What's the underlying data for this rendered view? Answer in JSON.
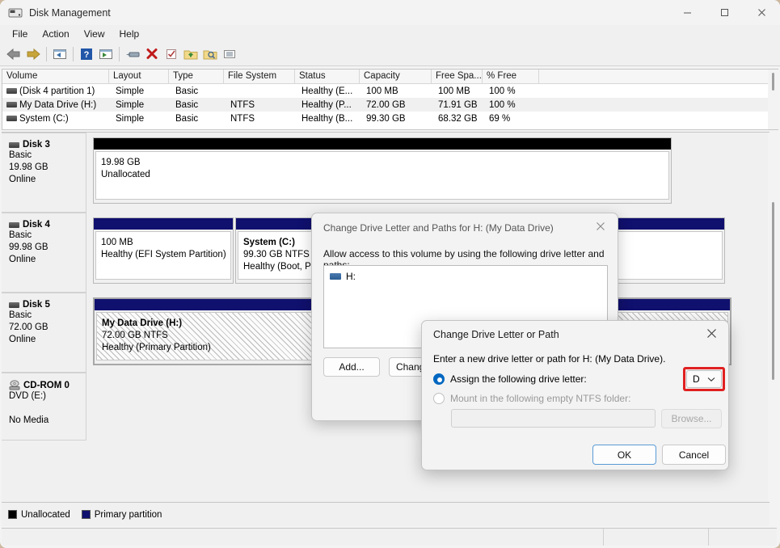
{
  "window": {
    "title": "Disk Management",
    "icon": "disk-management-icon",
    "minimize": "—",
    "maximize": "☐",
    "close": "✕"
  },
  "menu": {
    "items": [
      "File",
      "Action",
      "View",
      "Help"
    ]
  },
  "toolbar": {
    "icons": [
      "back-arrow-icon",
      "forward-arrow-icon",
      "sep",
      "up-one-level-icon",
      "sep",
      "help-icon",
      "show-hide-console-tree-icon",
      "sep",
      "properties-icon",
      "delete-icon",
      "check-icon",
      "export-list-icon",
      "find-icon",
      "view-list-icon"
    ]
  },
  "volume_list": {
    "columns": [
      "Volume",
      "Layout",
      "Type",
      "File System",
      "Status",
      "Capacity",
      "Free Spa...",
      "% Free"
    ],
    "rows": [
      {
        "volume": "(Disk 4 partition 1)",
        "layout": "Simple",
        "type": "Basic",
        "file_system": "",
        "status": "Healthy (E...",
        "capacity": "100 MB",
        "free_space": "100 MB",
        "percent_free": "100 %",
        "selected": false
      },
      {
        "volume": "My Data Drive (H:)",
        "layout": "Simple",
        "type": "Basic",
        "file_system": "NTFS",
        "status": "Healthy (P...",
        "capacity": "72.00 GB",
        "free_space": "71.91 GB",
        "percent_free": "100 %",
        "selected": true
      },
      {
        "volume": "System (C:)",
        "layout": "Simple",
        "type": "Basic",
        "file_system": "NTFS",
        "status": "Healthy (B...",
        "capacity": "99.30 GB",
        "free_space": "68.32 GB",
        "percent_free": "69 %",
        "selected": false
      }
    ]
  },
  "disk_map": {
    "disks": [
      {
        "name": "Disk 3",
        "type": "Basic",
        "size": "19.98 GB",
        "state": "Online",
        "partitions": [
          {
            "title": "",
            "line1": "19.98 GB",
            "line2": "Unallocated",
            "cap": "black",
            "selected": false
          }
        ]
      },
      {
        "name": "Disk 4",
        "type": "Basic",
        "size": "99.98 GB",
        "state": "Online",
        "partitions": [
          {
            "title": "",
            "line1": "100 MB",
            "line2": "Healthy (EFI System Partition)",
            "cap": "blue",
            "selected": false
          },
          {
            "title": "System  (C:)",
            "line1": "99.30 GB NTFS",
            "line2": "Healthy (Boot, Pag",
            "cap": "blue",
            "selected": false
          },
          {
            "title": "",
            "line1": "",
            "line2": "",
            "cap": "blue",
            "selected": false
          }
        ]
      },
      {
        "name": "Disk 5",
        "type": "Basic",
        "size": "72.00 GB",
        "state": "Online",
        "partitions": [
          {
            "title": "My Data Drive  (H:)",
            "line1": "72.00 GB NTFS",
            "line2": "Healthy (Primary Partition)",
            "cap": "blue",
            "selected": true
          }
        ]
      },
      {
        "name": "CD-ROM 0",
        "type": "DVD (E:)",
        "size": "",
        "state": "No Media",
        "partitions": []
      }
    ]
  },
  "legend": {
    "items": [
      {
        "label": "Unallocated",
        "color": "#000000"
      },
      {
        "label": "Primary partition",
        "color": "#10106e"
      }
    ]
  },
  "dialog_paths": {
    "title": "Change Drive Letter and Paths for H: (My Data Drive)",
    "close": "✕",
    "description": "Allow access to this volume by using the following drive letter and paths:",
    "list_items": [
      "H:"
    ],
    "buttons": {
      "add": "Add...",
      "change": "Change..."
    }
  },
  "dialog_change": {
    "title": "Change Drive Letter or Path",
    "close": "✕",
    "prompt": "Enter a new drive letter or path for H: (My Data Drive).",
    "option_assign": "Assign the following drive letter:",
    "option_mount": "Mount in the following empty NTFS folder:",
    "drive_letter_value": "D",
    "chevron": "⌄",
    "folder_path_value": "",
    "browse": "Browse...",
    "ok": "OK",
    "cancel": "Cancel",
    "highlight_color": "#e02020"
  }
}
